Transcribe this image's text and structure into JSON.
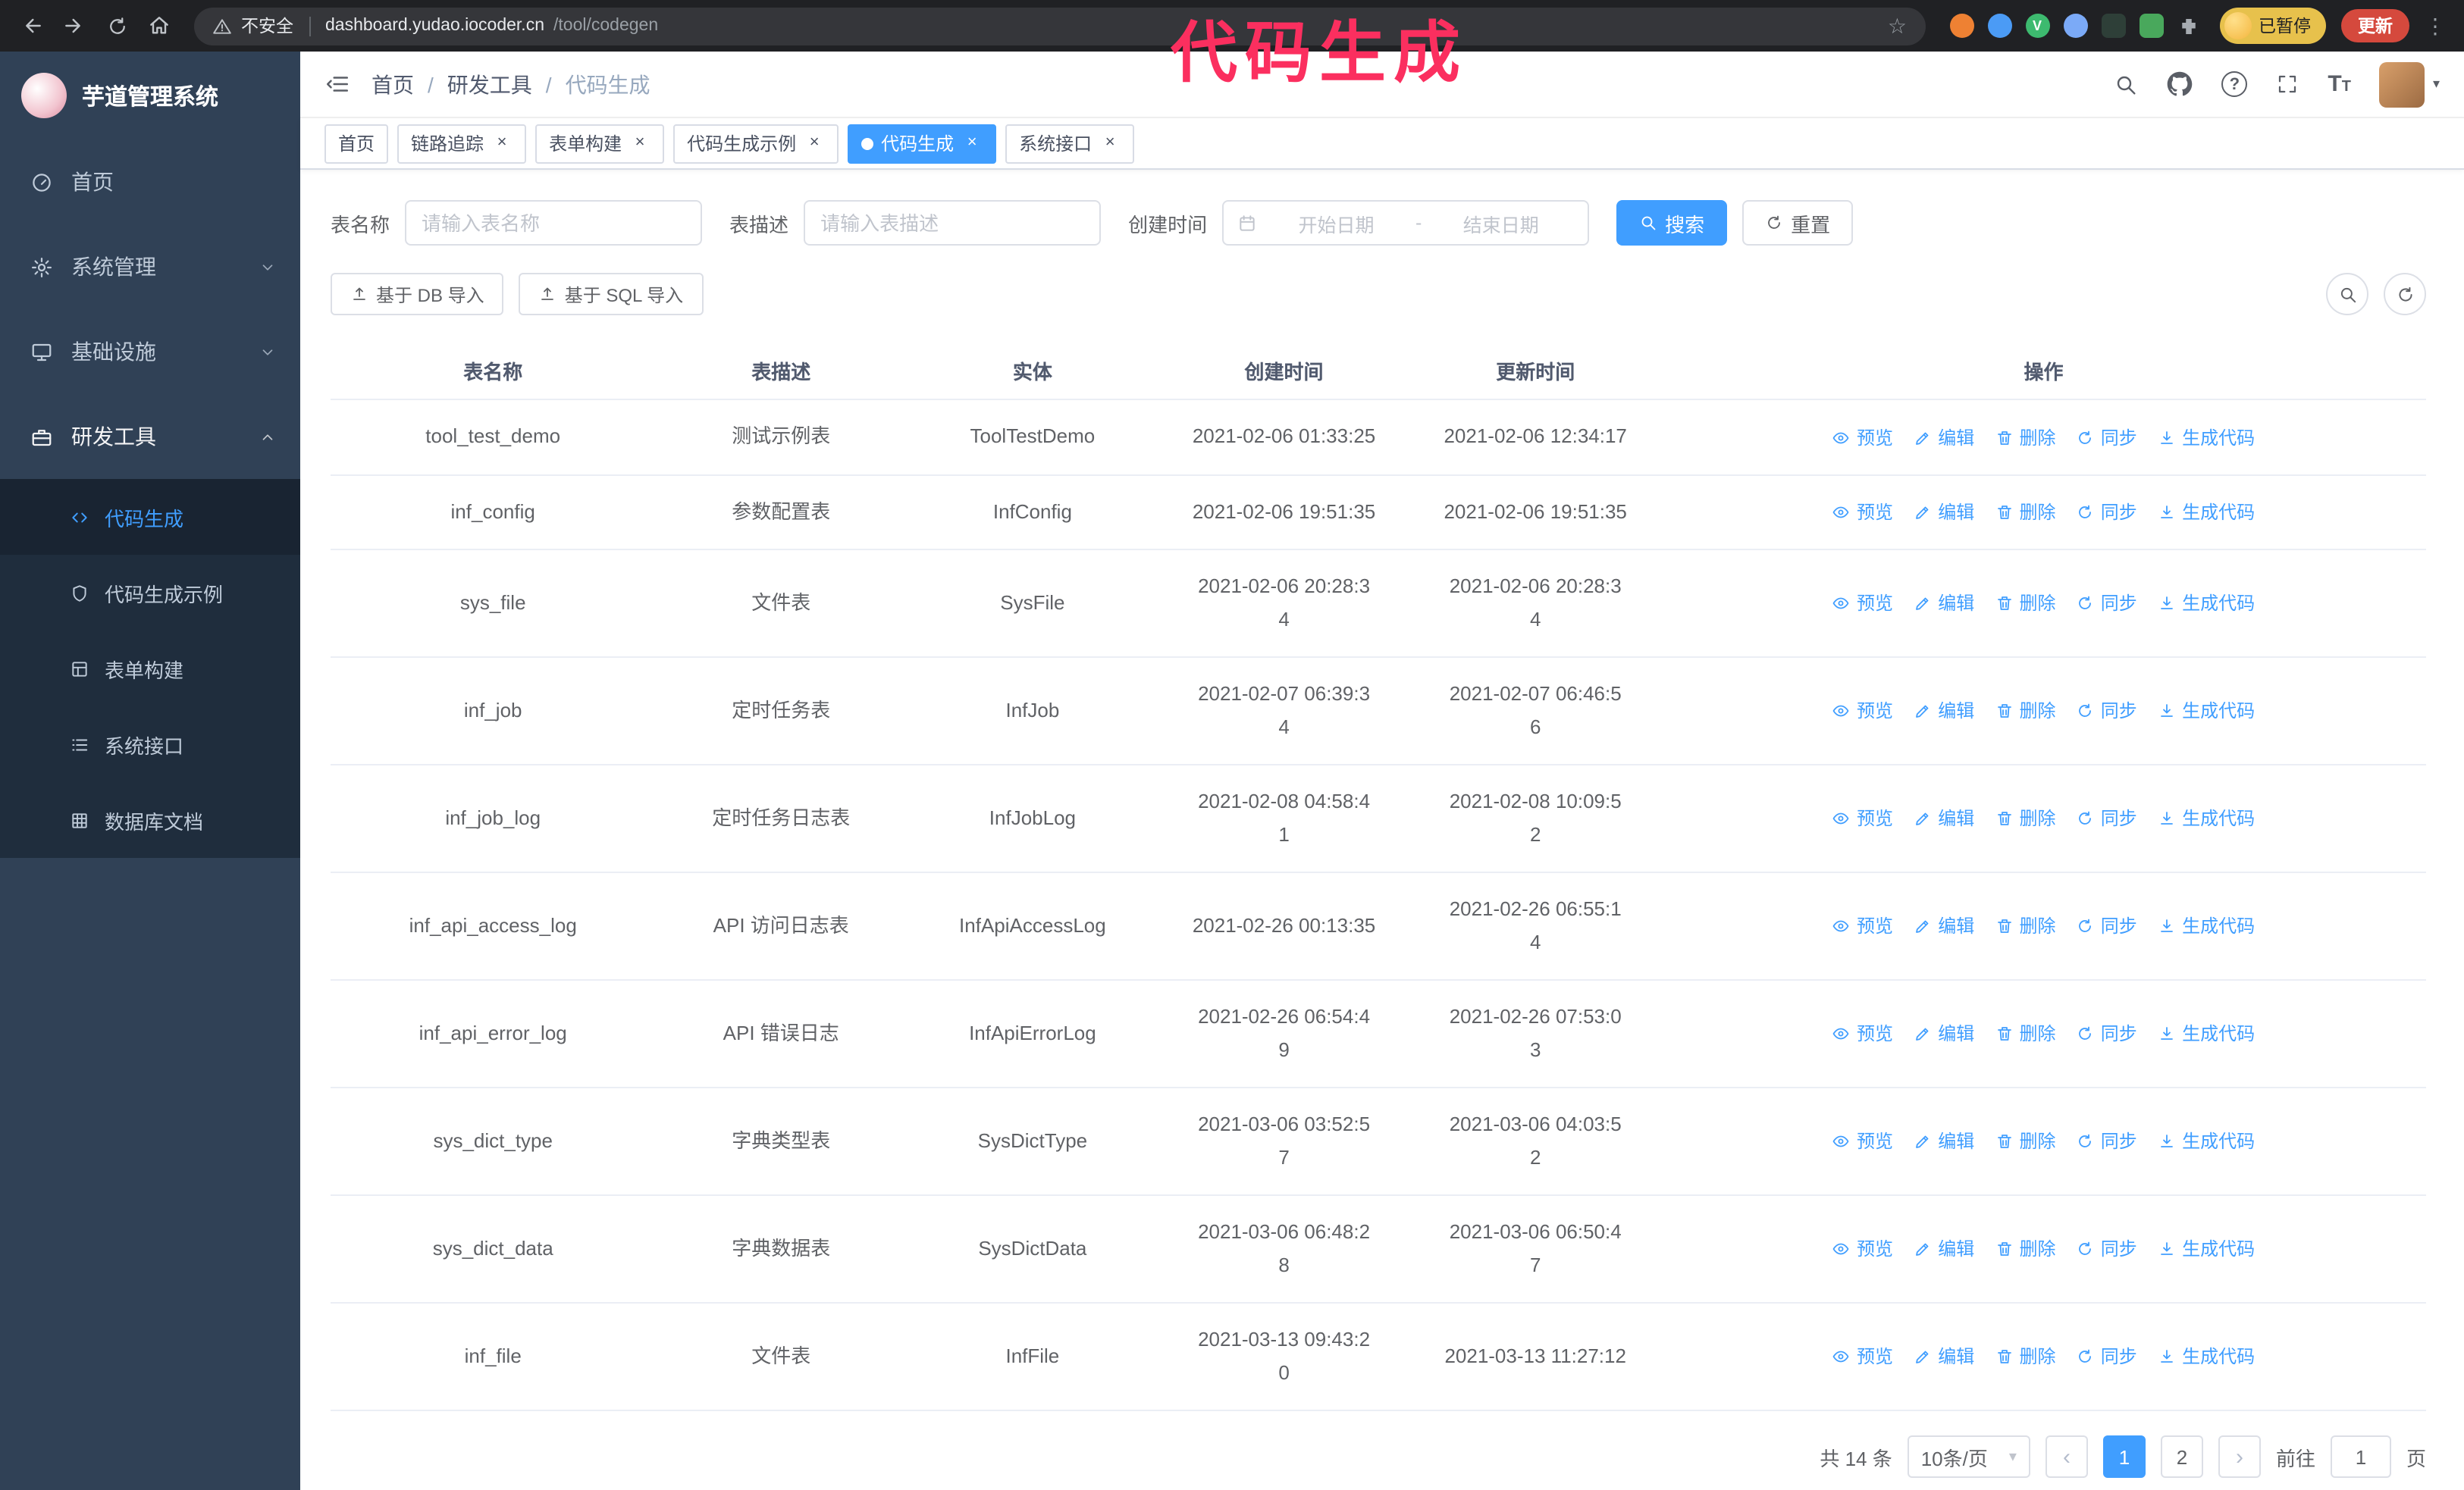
{
  "theme": {
    "primary": "#409eff",
    "sidebar_bg": "#304156",
    "submenu_bg": "#1f2d3d",
    "chrome_bg": "#202124",
    "annotation_color": "#fb2f5f",
    "update_button_bg": "#d5493d",
    "paused_badge_bg": "#e7c14c"
  },
  "annotation": {
    "text": "代码生成"
  },
  "browser": {
    "security_label": "不安全",
    "url_host": "dashboard.yudao.iocoder.cn",
    "url_path": "/tool/codegen",
    "bookmark_star": "☆",
    "vue_badge": "V",
    "paused_badge": "已暂停",
    "update_button": "更新",
    "menu_glyph": "⋮"
  },
  "sidebar": {
    "title": "芋道管理系统",
    "items": [
      {
        "label": "首页"
      },
      {
        "label": "系统管理"
      },
      {
        "label": "基础设施"
      },
      {
        "label": "研发工具"
      }
    ],
    "submenu": [
      {
        "label": "代码生成",
        "active": true
      },
      {
        "label": "代码生成示例"
      },
      {
        "label": "表单构建"
      },
      {
        "label": "系统接口"
      },
      {
        "label": "数据库文档"
      }
    ]
  },
  "header": {
    "breadcrumb": [
      "首页",
      "研发工具",
      "代码生成"
    ],
    "separator": "/"
  },
  "tabs": [
    {
      "label": "首页",
      "closable": false,
      "active": false
    },
    {
      "label": "链路追踪",
      "closable": true,
      "active": false
    },
    {
      "label": "表单构建",
      "closable": true,
      "active": false
    },
    {
      "label": "代码生成示例",
      "closable": true,
      "active": false
    },
    {
      "label": "代码生成",
      "closable": true,
      "active": true
    },
    {
      "label": "系统接口",
      "closable": true,
      "active": false
    }
  ],
  "filters": {
    "table_name_label": "表名称",
    "table_name_placeholder": "请输入表名称",
    "table_desc_label": "表描述",
    "table_desc_placeholder": "请输入表描述",
    "create_time_label": "创建时间",
    "date_start_placeholder": "开始日期",
    "date_separator": "-",
    "date_end_placeholder": "结束日期",
    "search_button": "搜索",
    "reset_button": "重置"
  },
  "toolbar": {
    "import_db_button": "基于 DB 导入",
    "import_sql_button": "基于 SQL 导入"
  },
  "table": {
    "columns": [
      "表名称",
      "表描述",
      "实体",
      "创建时间",
      "更新时间",
      "操作"
    ],
    "actions": [
      "预览",
      "编辑",
      "删除",
      "同步",
      "生成代码"
    ],
    "rows": [
      {
        "name": "tool_test_demo",
        "desc": "测试示例表",
        "entity": "ToolTestDemo",
        "created": "2021-02-06 01:33:25",
        "updated": "2021-02-06 12:34:17"
      },
      {
        "name": "inf_config",
        "desc": "参数配置表",
        "entity": "InfConfig",
        "created": "2021-02-06 19:51:35",
        "updated": "2021-02-06 19:51:35"
      },
      {
        "name": "sys_file",
        "desc": "文件表",
        "entity": "SysFile",
        "created": "2021-02-06 20:28:3\n4",
        "updated": "2021-02-06 20:28:3\n4"
      },
      {
        "name": "inf_job",
        "desc": "定时任务表",
        "entity": "InfJob",
        "created": "2021-02-07 06:39:3\n4",
        "updated": "2021-02-07 06:46:5\n6"
      },
      {
        "name": "inf_job_log",
        "desc": "定时任务日志表",
        "entity": "InfJobLog",
        "created": "2021-02-08 04:58:4\n1",
        "updated": "2021-02-08 10:09:5\n2"
      },
      {
        "name": "inf_api_access_log",
        "desc": "API 访问日志表",
        "entity": "InfApiAccessLog",
        "created": "2021-02-26 00:13:35",
        "updated": "2021-02-26 06:55:1\n4"
      },
      {
        "name": "inf_api_error_log",
        "desc": "API 错误日志",
        "entity": "InfApiErrorLog",
        "created": "2021-02-26 06:54:4\n9",
        "updated": "2021-02-26 07:53:0\n3"
      },
      {
        "name": "sys_dict_type",
        "desc": "字典类型表",
        "entity": "SysDictType",
        "created": "2021-03-06 03:52:5\n7",
        "updated": "2021-03-06 04:03:5\n2"
      },
      {
        "name": "sys_dict_data",
        "desc": "字典数据表",
        "entity": "SysDictData",
        "created": "2021-03-06 06:48:2\n8",
        "updated": "2021-03-06 06:50:4\n7"
      },
      {
        "name": "inf_file",
        "desc": "文件表",
        "entity": "InfFile",
        "created": "2021-03-13 09:43:2\n0",
        "updated": "2021-03-13 11:27:12"
      }
    ]
  },
  "pagination": {
    "total": "共 14 条",
    "page_size": "10条/页",
    "prev": "‹",
    "next": "›",
    "pages": [
      "1",
      "2"
    ],
    "active_page": "1",
    "goto_label": "前往",
    "goto_value": "1",
    "goto_unit": "页"
  }
}
